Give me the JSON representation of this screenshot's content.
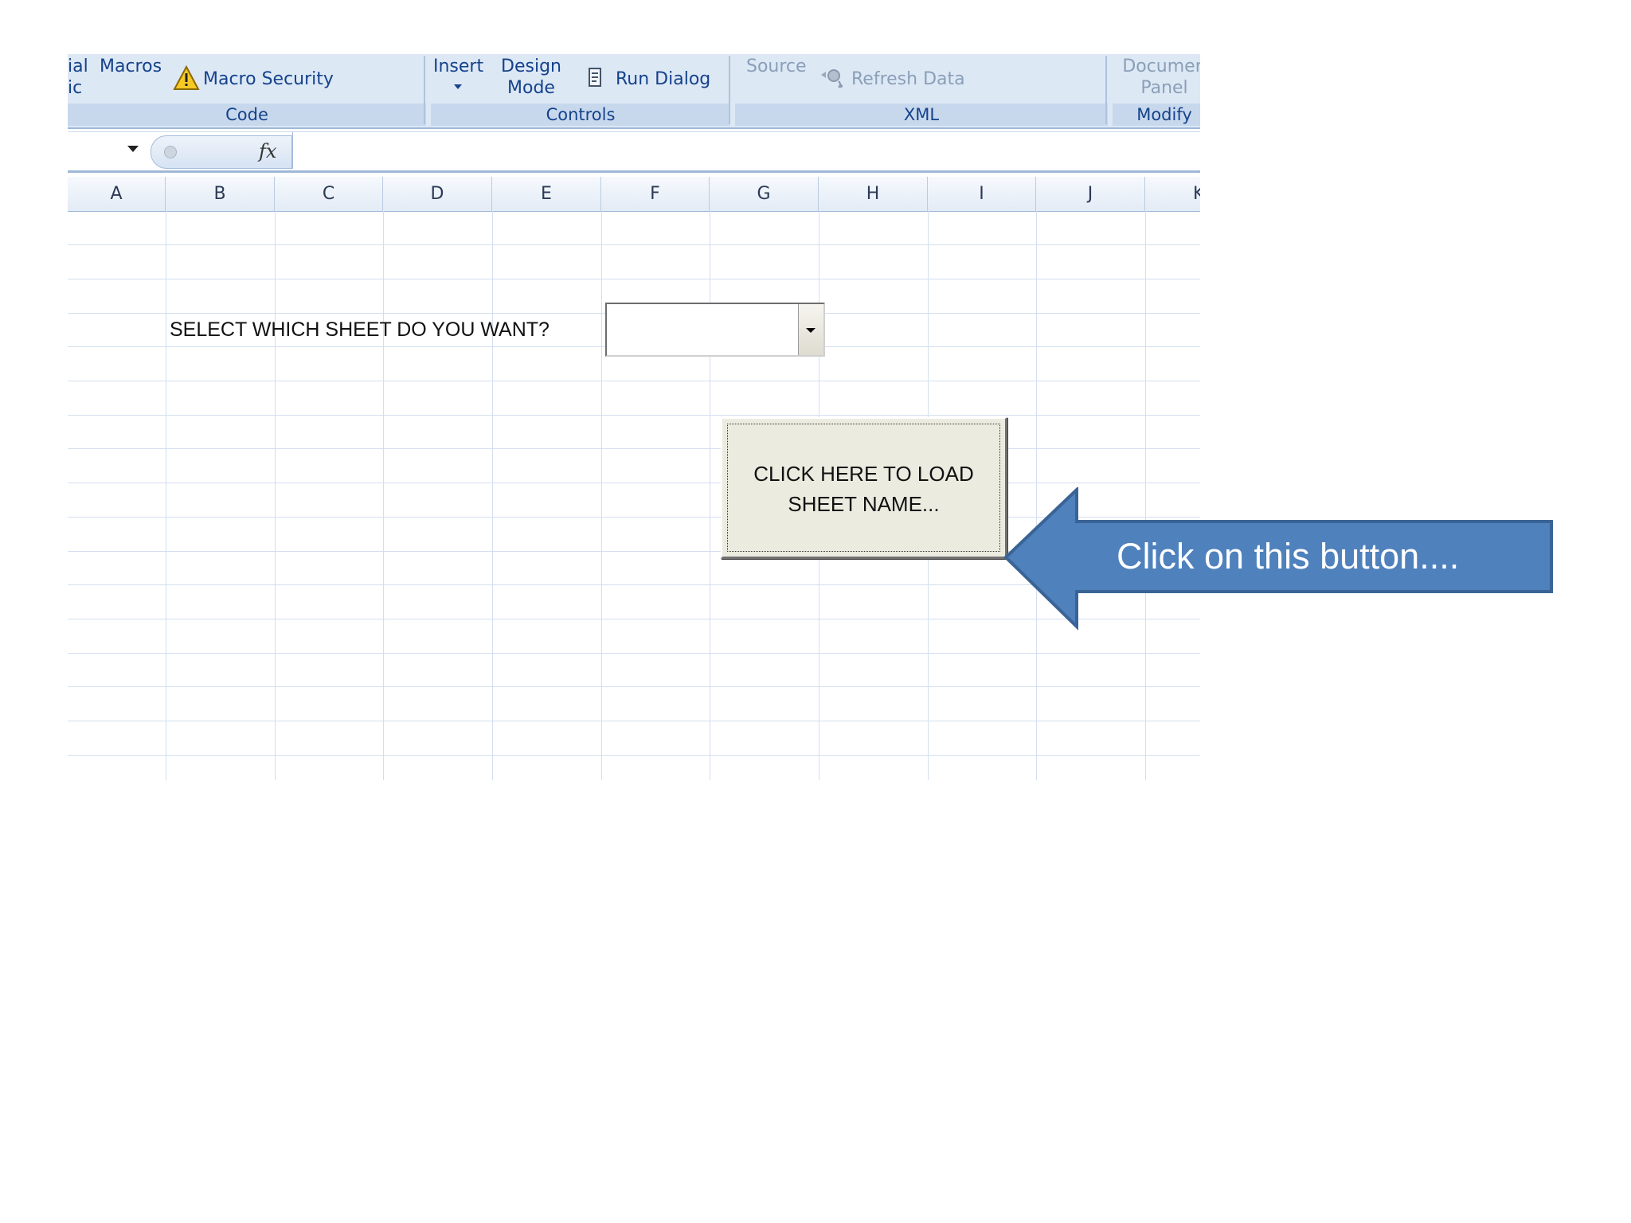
{
  "ribbon": {
    "code": {
      "visual_basic_line1": "ial",
      "visual_basic_line2": "ic",
      "macros": "Macros",
      "macro_security": "Macro Security",
      "label": "Code"
    },
    "controls": {
      "insert": "Insert",
      "design_line1": "Design",
      "design_line2": "Mode",
      "run_dialog": "Run Dialog",
      "label": "Controls"
    },
    "xml": {
      "source": "Source",
      "refresh_data": "Refresh Data",
      "label": "XML"
    },
    "modify": {
      "document_line1": "Documen",
      "document_line2": "Panel",
      "label": "Modify"
    }
  },
  "formula_bar": {
    "fx": "fx",
    "value": ""
  },
  "columns": [
    "A",
    "B",
    "C",
    "D",
    "E",
    "F",
    "G",
    "H",
    "I",
    "J",
    "K"
  ],
  "sheet": {
    "prompt": "SELECT WHICH SHEET DO YOU WANT?",
    "combo_value": "",
    "load_button_line1": "CLICK HERE TO LOAD",
    "load_button_line2": "SHEET NAME..."
  },
  "callout": {
    "text": "Click on this button....",
    "fill_color": "#4f81bd",
    "border_color": "#3a6396"
  }
}
